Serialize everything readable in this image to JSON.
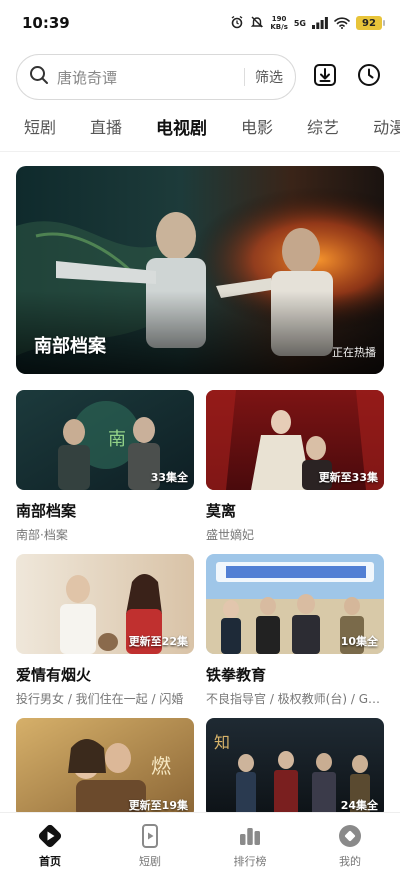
{
  "status_bar": {
    "time": "10:39",
    "net_speed_value": "190",
    "net_speed_unit": "KB/s",
    "network": "5G",
    "battery": "92",
    "icons": [
      "alarm-icon",
      "mute-icon",
      "signal-icon",
      "wifi-icon",
      "battery-icon"
    ]
  },
  "search": {
    "placeholder": "唐诡奇谭",
    "filter_label": "筛选"
  },
  "header_actions": [
    "download-icon",
    "history-icon"
  ],
  "tabs": [
    {
      "label": "短剧",
      "active": false
    },
    {
      "label": "直播",
      "active": false
    },
    {
      "label": "电视剧",
      "active": true
    },
    {
      "label": "电影",
      "active": false
    },
    {
      "label": "综艺",
      "active": false
    },
    {
      "label": "动漫",
      "active": false
    }
  ],
  "hero": {
    "title": "南部档案",
    "tag": "正在热播"
  },
  "cards": [
    {
      "title": "南部档案",
      "subtitle": "南部·档案",
      "badge": "33集全"
    },
    {
      "title": "莫离",
      "subtitle": "盛世嫡妃",
      "badge": "更新至33集"
    },
    {
      "title": "爱情有烟火",
      "subtitle": "投行男女 / 我们住在一起 / 闪婚",
      "badge": "更新至22集"
    },
    {
      "title": "铁拳教育",
      "subtitle": "不良指导官 / 极权教师(台) / G…",
      "badge": "10集全"
    },
    {
      "title": "",
      "subtitle": "",
      "badge": "更新至19集"
    },
    {
      "title": "",
      "subtitle": "",
      "badge": "24集全"
    }
  ],
  "bottom_nav": [
    {
      "label": "首页",
      "icon": "home-play-icon",
      "active": true
    },
    {
      "label": "短剧",
      "icon": "phone-play-icon",
      "active": false
    },
    {
      "label": "排行榜",
      "icon": "bar-chart-icon",
      "active": false
    },
    {
      "label": "我的",
      "icon": "profile-icon",
      "active": false
    }
  ],
  "colors": {
    "accent": "#111111",
    "battery": "#e8c43a",
    "muted_text": "#777777"
  }
}
